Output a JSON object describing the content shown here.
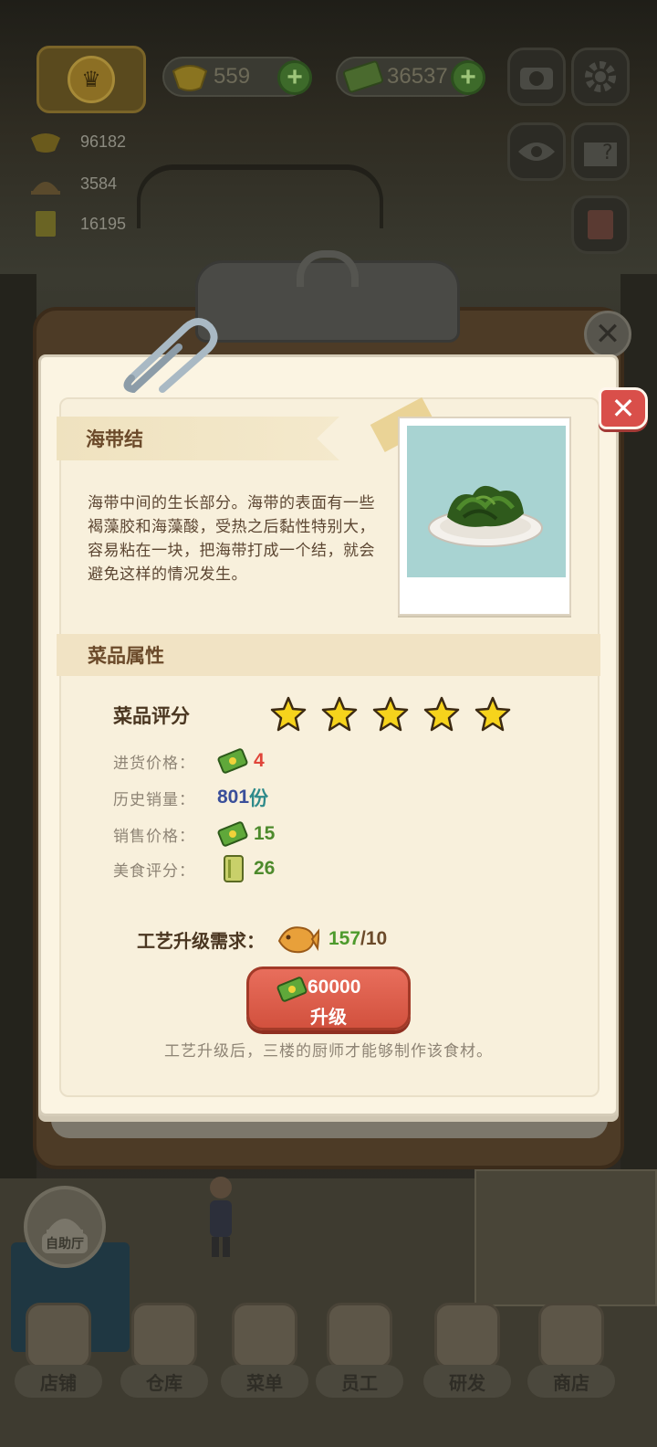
{
  "hud": {
    "ingots": "559",
    "cash": "36537",
    "stats": [
      "96182",
      "3584",
      "16195"
    ]
  },
  "dish": {
    "name": "海带结",
    "description": "海带中间的生长部分。海带的表面有一些褐藻胶和海藻酸，受热之后黏性特别大，容易粘在一块，把海带打成一个结，就会避免这样的情况发生。"
  },
  "attributes": {
    "section_title": "菜品属性",
    "rating_label": "菜品评分",
    "rating_stars": 5,
    "purchase_label": "进货价格：",
    "purchase_value": "4",
    "sales_label": "历史销量：",
    "sales_value": "801",
    "sales_unit": "份",
    "price_label": "销售价格：",
    "price_value": "15",
    "food_score_label": "美食评分：",
    "food_score_value": "26"
  },
  "upgrade": {
    "req_label": "工艺升级需求：",
    "req_have": "157",
    "req_need": "/10",
    "cost": "60000",
    "button_label": "升级",
    "hint": "工艺升级后，三楼的厨师才能够制作该食材。"
  },
  "buffet_label": "自助厅",
  "nav": [
    {
      "label": "店铺"
    },
    {
      "label": "仓库"
    },
    {
      "label": "菜单"
    },
    {
      "label": "员工"
    },
    {
      "label": "研发"
    },
    {
      "label": "商店"
    }
  ],
  "colors": {
    "accent_red": "#d94f4a",
    "paper": "#fbf4e2",
    "value_green": "#4d8a2c",
    "value_red": "#e0453a"
  }
}
